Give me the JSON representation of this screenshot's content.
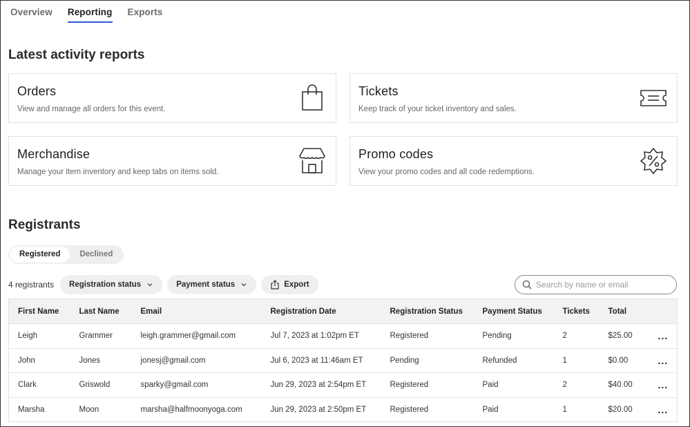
{
  "tabs": [
    {
      "label": "Overview",
      "active": false
    },
    {
      "label": "Reporting",
      "active": true
    },
    {
      "label": "Exports",
      "active": false
    }
  ],
  "reports": {
    "title": "Latest activity reports",
    "cards": [
      {
        "title": "Orders",
        "description": "View and manage all orders for this event.",
        "icon": "shopping-bag-icon"
      },
      {
        "title": "Tickets",
        "description": "Keep track of your ticket inventory and sales.",
        "icon": "ticket-icon"
      },
      {
        "title": "Merchandise",
        "description": "Manage your item inventory and keep tabs on items sold.",
        "icon": "storefront-icon"
      },
      {
        "title": "Promo codes",
        "description": "View your promo codes and all code redemptions.",
        "icon": "promo-badge-icon"
      }
    ]
  },
  "registrants": {
    "title": "Registrants",
    "segments": [
      {
        "label": "Registered",
        "active": true
      },
      {
        "label": "Declined",
        "active": false
      }
    ],
    "count_label": "4 registrants",
    "filters": {
      "registration_status": "Registration status",
      "payment_status": "Payment status",
      "export": "Export"
    },
    "search_placeholder": "Search by name or email",
    "columns": [
      "First Name",
      "Last Name",
      "Email",
      "Registration Date",
      "Registration Status",
      "Payment Status",
      "Tickets",
      "Total"
    ],
    "rows": [
      [
        "Leigh",
        "Grammer",
        "leigh.grammer@gmail.com",
        "Jul 7, 2023 at 1:02pm ET",
        "Registered",
        "Pending",
        "2",
        "$25.00"
      ],
      [
        "John",
        "Jones",
        "jonesj@gmail.com",
        "Jul 6, 2023 at 11:46am ET",
        "Pending",
        "Refunded",
        "1",
        "$0.00"
      ],
      [
        "Clark",
        "Griswold",
        "sparky@gmail.com",
        "Jun 29, 2023 at 2:54pm ET",
        "Registered",
        "Paid",
        "2",
        "$40.00"
      ],
      [
        "Marsha",
        "Moon",
        "marsha@halfmoonyoga.com",
        "Jun 29, 2023 at 2:50pm ET",
        "Registered",
        "Paid",
        "1",
        "$20.00"
      ]
    ],
    "row_action": "..."
  },
  "colors": {
    "accent": "#2f5bd3"
  }
}
